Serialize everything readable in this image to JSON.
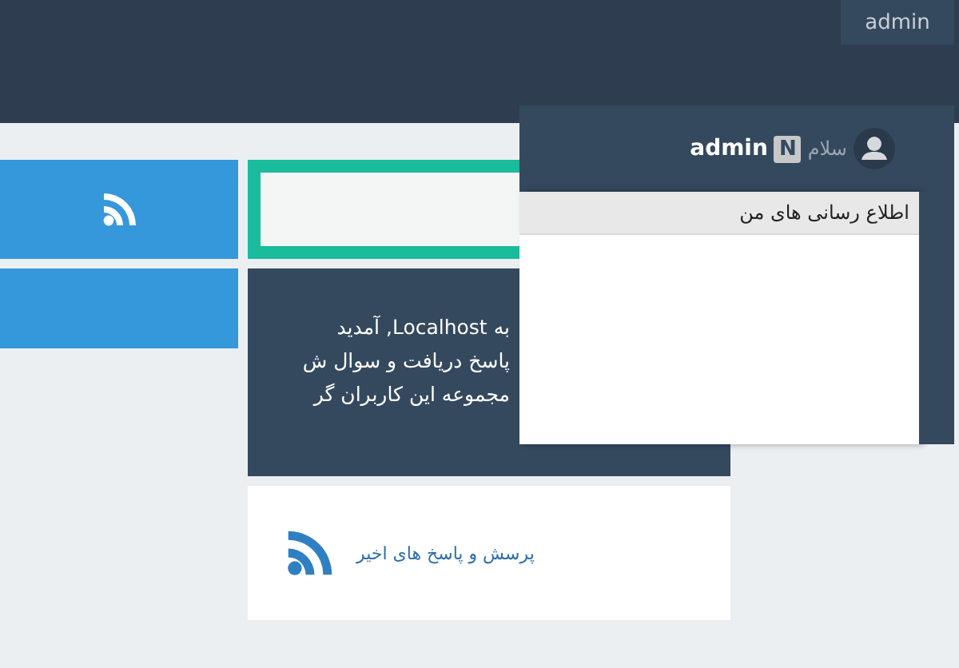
{
  "top_bar": {
    "user_button": "admin"
  },
  "welcome_card": {
    "lines": [
      "به Localhost, آمدید",
      "پاسخ دریافت و سوال ش",
      "مجموعه این کاربران گر"
    ]
  },
  "recent_card": {
    "link": "پرسش و پاسخ های اخیر"
  },
  "user_panel": {
    "greeting": "سلام",
    "badge": "N",
    "username": "admin",
    "notifications_title": "اطلاع رسانی های من"
  }
}
